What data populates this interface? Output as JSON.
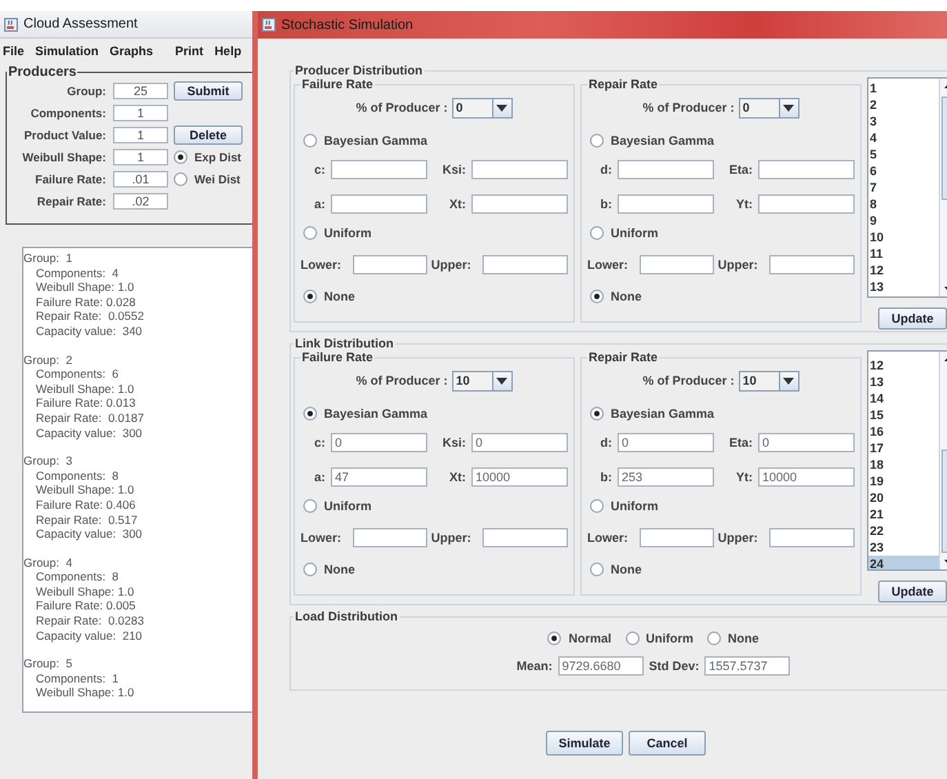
{
  "left_window": {
    "title": "Cloud Assessment",
    "menu": [
      "File",
      "Simulation",
      "Graphs",
      "Print",
      "Help"
    ],
    "producers": {
      "title": "Producers",
      "fields": [
        {
          "label": "Group:",
          "value": "25",
          "side": {
            "kind": "button",
            "label": "Submit"
          }
        },
        {
          "label": "Components:",
          "value": "1"
        },
        {
          "label": "Product Value:",
          "value": "1",
          "side": {
            "kind": "button",
            "label": "Delete"
          }
        },
        {
          "label": "Weibull Shape:",
          "value": "1",
          "side": {
            "kind": "radio",
            "label": "Exp Dist",
            "selected": true
          }
        },
        {
          "label": "Failure Rate:",
          "value": ".01",
          "side": {
            "kind": "radio",
            "label": "Wei Dist",
            "selected": false
          }
        },
        {
          "label": "Repair Rate:",
          "value": ".02"
        }
      ]
    },
    "groups": [
      {
        "title": "Group:  1",
        "lines": [
          "Components:  4",
          "Weibull Shape: 1.0",
          "Failure Rate: 0.028",
          "Repair Rate:  0.0552",
          "Capacity value:  340"
        ]
      },
      {
        "title": "Group:  2",
        "lines": [
          "Components:  6",
          "Weibull Shape: 1.0",
          "Failure Rate: 0.013",
          "Repair Rate:  0.0187",
          "Capacity value:  300"
        ]
      },
      {
        "title": "Group:  3",
        "lines": [
          "Components:  8",
          "Weibull Shape: 1.0",
          "Failure Rate: 0.406",
          "Repair Rate:  0.517",
          "Capacity value:  300"
        ]
      },
      {
        "title": "Group:  4",
        "lines": [
          "Components:  8",
          "Weibull Shape: 1.0",
          "Failure Rate: 0.005",
          "Repair Rate:  0.0283",
          "Capacity value:  210"
        ]
      },
      {
        "title": "Group:  5",
        "lines": [
          "Components:  1",
          "Weibull Shape: 1.0"
        ]
      }
    ]
  },
  "right_window": {
    "title": "Stochastic Simulation",
    "sections": [
      {
        "title": "Producer Distribution",
        "panels": [
          {
            "title": "Failure Rate",
            "percent": {
              "label": "% of Producer :",
              "value": "0"
            },
            "options": [
              {
                "label": "Bayesian Gamma",
                "selected": false
              },
              {
                "label": "Uniform",
                "selected": false
              },
              {
                "label": "None",
                "selected": true
              }
            ],
            "gamma_fields": [
              {
                "label": "c:"
              },
              {
                "label": "Ksi:"
              },
              {
                "label": "a:"
              },
              {
                "label": "Xt:"
              }
            ],
            "range_fields": [
              {
                "label": "Lower:"
              },
              {
                "label": "Upper:"
              }
            ]
          },
          {
            "title": "Repair Rate",
            "percent": {
              "label": "% of Producer :",
              "value": "0"
            },
            "options": [
              {
                "label": "Bayesian Gamma",
                "selected": false
              },
              {
                "label": "Uniform",
                "selected": false
              },
              {
                "label": "None",
                "selected": true
              }
            ],
            "gamma_fields": [
              {
                "label": "d:"
              },
              {
                "label": "Eta:"
              },
              {
                "label": "b:"
              },
              {
                "label": "Yt:"
              }
            ],
            "range_fields": [
              {
                "label": "Lower:"
              },
              {
                "label": "Upper:"
              }
            ]
          }
        ],
        "list": {
          "items": [
            {
              "label": "1",
              "selected": false
            },
            {
              "label": "2",
              "selected": false
            },
            {
              "label": "3",
              "selected": false
            },
            {
              "label": "4",
              "selected": false
            },
            {
              "label": "5",
              "selected": false
            },
            {
              "label": "6",
              "selected": false
            },
            {
              "label": "7",
              "selected": false
            },
            {
              "label": "8",
              "selected": false
            },
            {
              "label": "9",
              "selected": false
            },
            {
              "label": "10",
              "selected": false
            },
            {
              "label": "11",
              "selected": false
            },
            {
              "label": "12",
              "selected": false
            },
            {
              "label": "13",
              "selected": false
            }
          ],
          "button": "Update"
        }
      },
      {
        "title": "Link Distribution",
        "panels": [
          {
            "title": "Failure Rate",
            "percent": {
              "label": "% of Producer :",
              "value": "10"
            },
            "options": [
              {
                "label": "Bayesian Gamma",
                "selected": true
              },
              {
                "label": "Uniform",
                "selected": false
              },
              {
                "label": "None",
                "selected": false
              }
            ],
            "gamma_fields": [
              {
                "label": "c:",
                "value": "0"
              },
              {
                "label": "Ksi:",
                "value": "0"
              },
              {
                "label": "a:",
                "value": "47"
              },
              {
                "label": "Xt:",
                "value": "10000"
              }
            ],
            "range_fields": [
              {
                "label": "Lower:"
              },
              {
                "label": "Upper:"
              }
            ]
          },
          {
            "title": "Repair Rate",
            "percent": {
              "label": "% of Producer :",
              "value": "10"
            },
            "options": [
              {
                "label": "Bayesian Gamma",
                "selected": true
              },
              {
                "label": "Uniform",
                "selected": false
              },
              {
                "label": "None",
                "selected": false
              }
            ],
            "gamma_fields": [
              {
                "label": "d:",
                "value": "0"
              },
              {
                "label": "Eta:",
                "value": "0"
              },
              {
                "label": "b:",
                "value": "253"
              },
              {
                "label": "Yt:",
                "value": "10000"
              }
            ],
            "range_fields": [
              {
                "label": "Lower:"
              },
              {
                "label": "Upper:"
              }
            ]
          }
        ],
        "list": {
          "items": [
            {
              "label": "12",
              "selected": false
            },
            {
              "label": "13",
              "selected": false
            },
            {
              "label": "14",
              "selected": false
            },
            {
              "label": "15",
              "selected": false
            },
            {
              "label": "16",
              "selected": false
            },
            {
              "label": "17",
              "selected": false
            },
            {
              "label": "18",
              "selected": false
            },
            {
              "label": "19",
              "selected": false
            },
            {
              "label": "20",
              "selected": false
            },
            {
              "label": "21",
              "selected": false
            },
            {
              "label": "22",
              "selected": false
            },
            {
              "label": "23",
              "selected": false
            },
            {
              "label": "24",
              "selected": true
            }
          ],
          "button": "Update"
        }
      }
    ],
    "load": {
      "title": "Load Distribution",
      "options": [
        {
          "label": "Normal",
          "selected": true
        },
        {
          "label": "Uniform",
          "selected": false
        },
        {
          "label": "None",
          "selected": false
        }
      ],
      "fields": [
        {
          "label": "Mean:",
          "value": "9729.6680"
        },
        {
          "label": "Std Dev:",
          "value": "1557.5737"
        }
      ]
    },
    "buttons": [
      "Simulate",
      "Cancel"
    ]
  }
}
